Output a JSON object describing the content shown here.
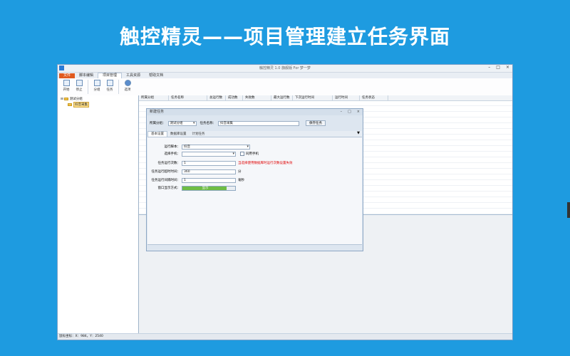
{
  "banner": "触控精灵——项目管理建立任务界面",
  "app": {
    "title": "触控精灵 1.0 旗舰版 For 梦一梦",
    "menu": [
      "文件",
      "脚本编辑",
      "项目管理",
      "工具资源",
      "帮助文档"
    ],
    "ribbon": [
      {
        "label": "开始",
        "icon": "play-icon"
      },
      {
        "label": "停止",
        "icon": "stop-icon"
      },
      {
        "label": "分组",
        "icon": "group-icon"
      },
      {
        "label": "任务",
        "icon": "task-icon"
      },
      {
        "label": "选项",
        "icon": "gear-icon"
      }
    ],
    "tree": {
      "root": "测试分组",
      "child": "抖音采集"
    },
    "grid_columns": [
      "所属分组",
      "任务名称",
      "总运行数",
      "成功数",
      "失败数",
      "最大运行数",
      "下次运行时间",
      "运行时间",
      "任务状态"
    ],
    "status": "鼠标坐标：X：984，Y：2540"
  },
  "dialog": {
    "title": "新建任务",
    "group_label": "所属分组：",
    "group_value": "测试分组",
    "name_label": "任务名称：",
    "name_value": "抖音采集",
    "save_button": "保存任务",
    "tabs": [
      "基本设置",
      "数据库设置",
      "计划任务"
    ],
    "fields": {
      "script_label": "运行脚本：",
      "script_value": "抖音",
      "phone_label": "选择手机：",
      "phone_value": "",
      "same_phone": "同用手机",
      "runs_label": "任务运行次数：",
      "runs_value": "1",
      "runs_hint": "当选择使用数据库时运行次数设置失效",
      "interval_label": "任务运行超时时间：",
      "interval_value": "360",
      "interval_unit": "分",
      "gap_label": "任务运行间隔时间：",
      "gap_value": "1",
      "gap_unit": "毫秒",
      "window_label": "窗口显示方式：",
      "window_value": "显示",
      "window_fill": 0.84
    }
  }
}
